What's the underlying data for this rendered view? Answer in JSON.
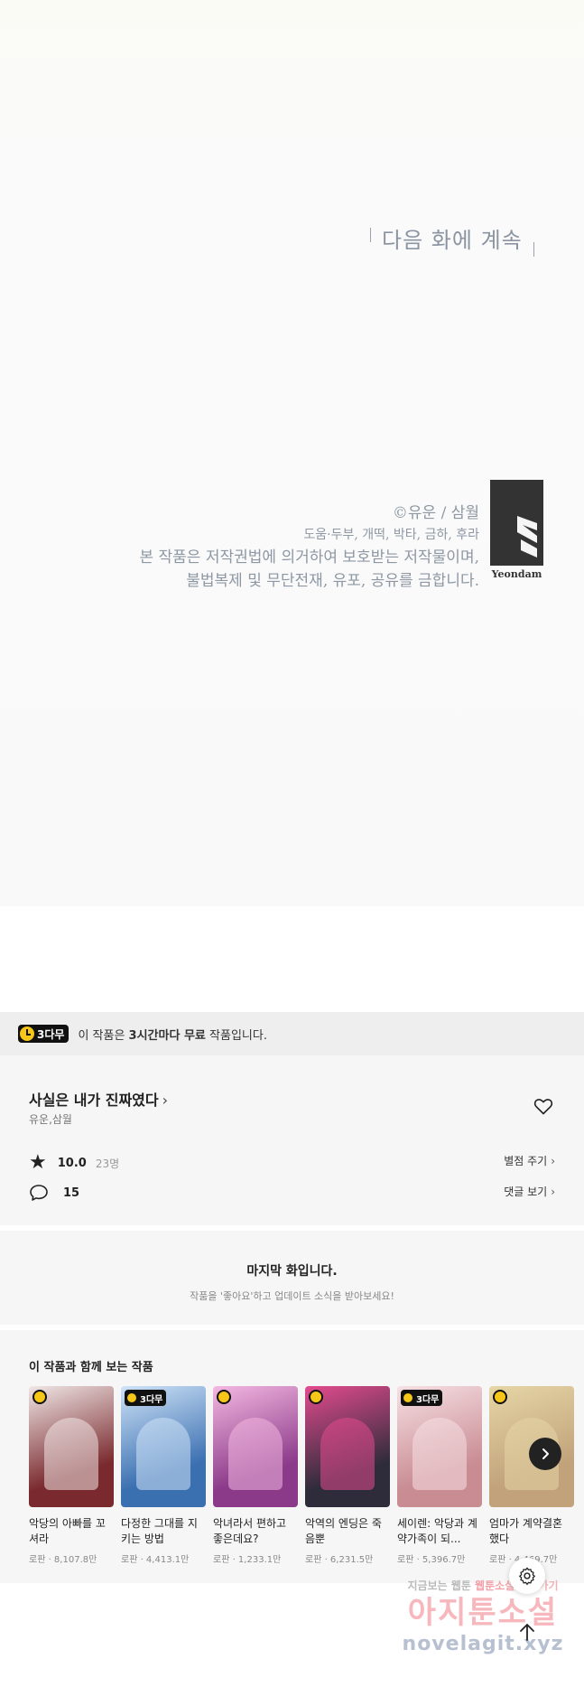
{
  "comic": {
    "to_be_continued": "다음 화에 계속",
    "credit_line1": "©유운 / 삼월",
    "credit_line2": "도움·두부, 개떡, 박타, 금하, 후라",
    "credit_line3": "본 작품은 저작권법에 의거하여 보호받는 저작물이며,",
    "credit_line4": "불법복제 및 무단전재, 유포, 공유를 금합니다.",
    "logo_text": "Yeondam"
  },
  "free_bar": {
    "badge": "3다무",
    "text_pre": "이 작품은 ",
    "text_bold": "3시간마다 무료",
    "text_post": " 작품입니다."
  },
  "work": {
    "title": "사실은 내가 진짜였다",
    "chevron": "›",
    "author": "유운,삼월",
    "rating": "10.0",
    "rating_count": "23명",
    "comment_count": "15",
    "rate_link": "별점 주기",
    "comments_link": "댓글 보기"
  },
  "last_episode": {
    "title": "마지막 화입니다.",
    "subtitle": "작품을 '좋아요'하고 업데이트 소식을 받아보세요!"
  },
  "recommendations": {
    "title": "이 작품과 함께 보는 작품",
    "items": [
      {
        "name": "악당의 아빠를 꼬셔라",
        "meta": "로판 · 8,107.8만",
        "badge": "",
        "bg": "#7a2a2e",
        "accent": "#f0e6e6"
      },
      {
        "name": "다정한 그대를 지키는 방법",
        "meta": "로판 · 4,413.1만",
        "badge": "3다무",
        "bg": "#3a6fb0",
        "accent": "#cfe3f8"
      },
      {
        "name": "악녀라서 편하고 좋은데요?",
        "meta": "로판 · 1,233.1만",
        "badge": "",
        "bg": "#8b3a8a",
        "accent": "#f3b8e0"
      },
      {
        "name": "악역의 엔딩은 죽음뿐",
        "meta": "로판 · 6,231.5만",
        "badge": "",
        "bg": "#2e2c3a",
        "accent": "#e34b8f"
      },
      {
        "name": "세이렌: 악당과 계약가족이 되...",
        "meta": "로판 · 5,396.7만",
        "badge": "3다무",
        "bg": "#c98c93",
        "accent": "#f6e0e4"
      },
      {
        "name": "엄마가 계약결혼 했다",
        "meta": "로판 · 4,469.7만",
        "badge": "",
        "bg": "#c1a27a",
        "accent": "#e6d6a6"
      }
    ]
  },
  "watermark": {
    "line1_a": "지금보는 웹툰 ",
    "line1_b": "웹툰소설 ",
    "line1_c": "보러가기",
    "line2": "아지툰소설",
    "line3": "novelagit.xyz"
  },
  "icons": {
    "next": "chevron-right-icon",
    "settings": "gear-icon",
    "scroll_top": "arrow-up-icon"
  }
}
